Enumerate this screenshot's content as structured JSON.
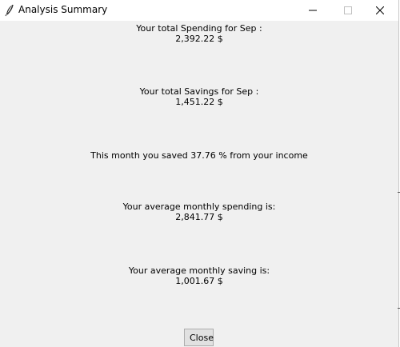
{
  "window": {
    "title": "Analysis Summary",
    "icon": "feather-icon",
    "controls": {
      "minimize": "minimize-icon",
      "maximize": "maximize-icon",
      "close": "close-icon"
    }
  },
  "summary": {
    "spending_label": "Your total Spending for Sep :",
    "spending_value": "2,392.22 $",
    "savings_label": "Your total Savings for Sep :",
    "savings_value": "1,451.22 $",
    "saved_message": "This month you saved 37.76 % from your income",
    "avg_spending_label": "Your average monthly spending is:",
    "avg_spending_value": "2,841.77 $",
    "avg_saving_label": "Your average monthly saving is:",
    "avg_saving_value": "1,001.67 $"
  },
  "actions": {
    "close_label": "Close"
  }
}
